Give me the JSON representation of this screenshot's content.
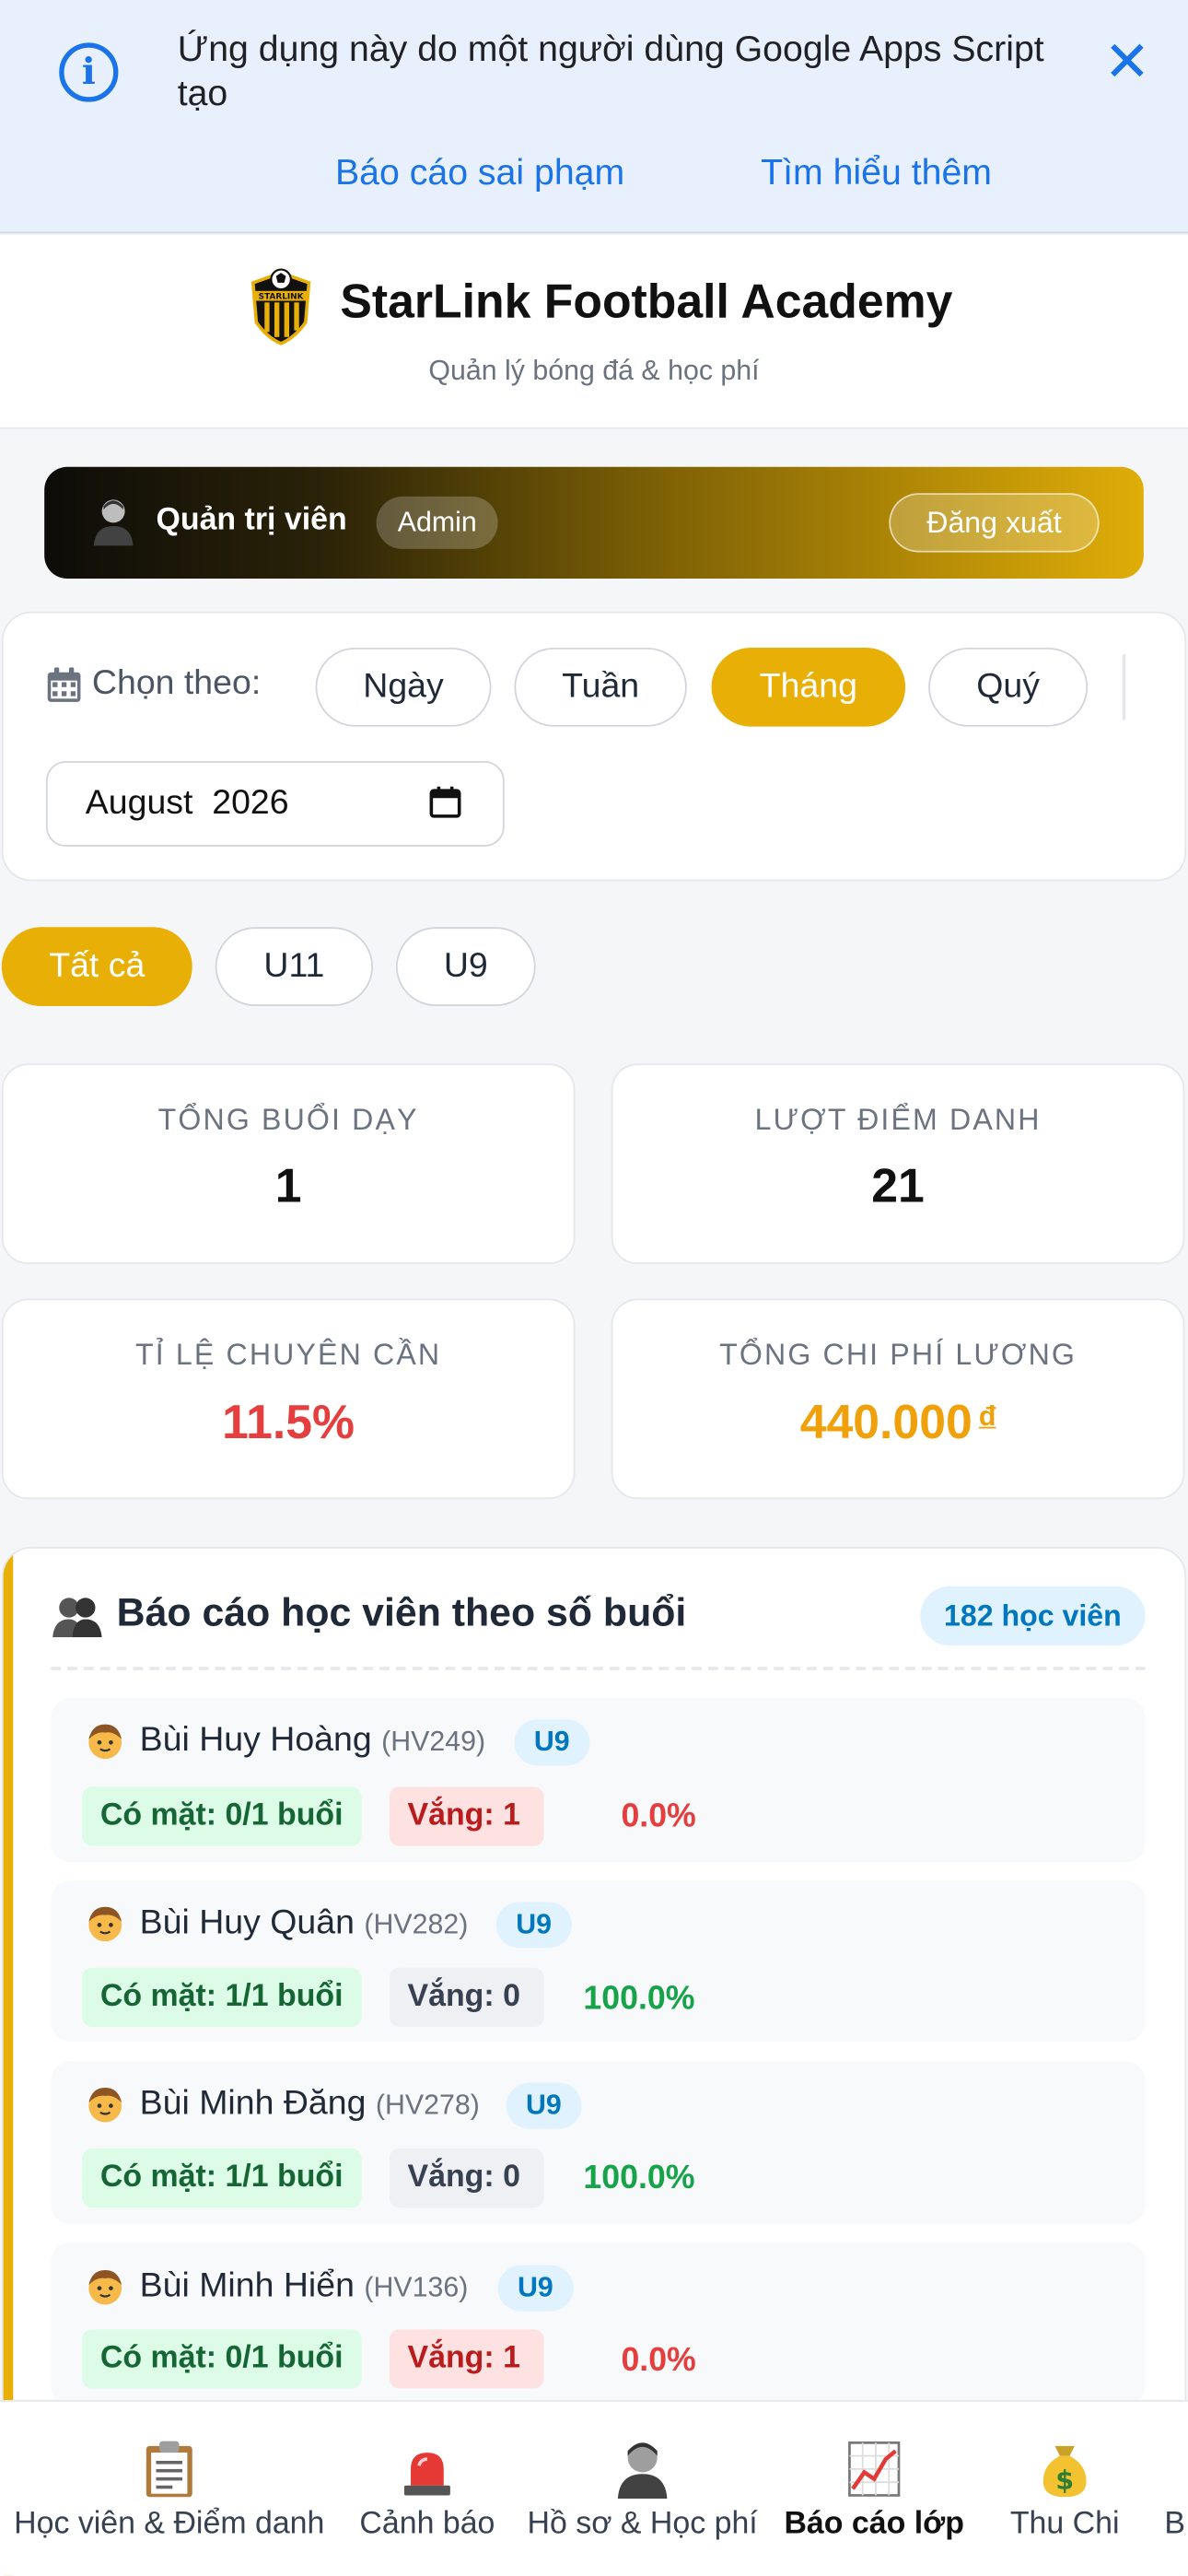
{
  "banner": {
    "message": "Ứng dụng này do một người dùng Google Apps Script tạo",
    "report_link": "Báo cáo sai phạm",
    "learn_link": "Tìm hiểu thêm",
    "close_icon": "close-icon",
    "info_icon": "info-icon",
    "info_glyph": "i",
    "close_glyph": "✕"
  },
  "header": {
    "title": "StarLink Football Academy",
    "subtitle": "Quản lý bóng đá & học phí",
    "logo_text": "STARLINK"
  },
  "user": {
    "name": "Quản trị viên",
    "role": "Admin",
    "logout_label": "Đăng xuất"
  },
  "filter": {
    "label": "Chọn theo:",
    "periods": [
      "Ngày",
      "Tuần",
      "Tháng",
      "Quý"
    ],
    "selected_period": "Tháng",
    "month_value": "August  2026"
  },
  "groups": {
    "items": [
      "Tất cả",
      "U11",
      "U9"
    ],
    "selected": "Tất cả"
  },
  "stats": {
    "total_sessions_label": "TỔNG BUỔI DẠY",
    "total_sessions_value": "1",
    "attendance_label": "LƯỢT ĐIỂM DANH",
    "attendance_value": "21",
    "rate_label": "TỈ LỆ CHUYÊN CẦN",
    "rate_value": "11.5%",
    "salary_label": "TỔNG CHI PHÍ LƯƠNG",
    "salary_value": "440.000",
    "currency": "đ"
  },
  "report": {
    "title": "Báo cáo học viên theo số buổi",
    "count_badge": "182 học viên",
    "students": [
      {
        "name": "Bùi Huy Hoàng",
        "id": "(HV249)",
        "group": "U9",
        "present": "Có mặt: 0/1 buổi",
        "absent": "Vắng: 1",
        "rate": "0.0%"
      },
      {
        "name": "Bùi Huy Quân",
        "id": "(HV282)",
        "group": "U9",
        "present": "Có mặt: 1/1 buổi",
        "absent": "Vắng: 0",
        "rate": "100.0%"
      },
      {
        "name": "Bùi Minh Đăng",
        "id": "(HV278)",
        "group": "U9",
        "present": "Có mặt: 1/1 buổi",
        "absent": "Vắng: 0",
        "rate": "100.0%"
      },
      {
        "name": "Bùi Minh Hiển",
        "id": "(HV136)",
        "group": "U9",
        "present": "Có mặt: 0/1 buổi",
        "absent": "Vắng: 1",
        "rate": "0.0%"
      }
    ]
  },
  "nav": {
    "items": [
      {
        "label": "Học viên & Điểm danh",
        "icon": "clipboard-icon"
      },
      {
        "label": "Cảnh báo",
        "icon": "siren-icon"
      },
      {
        "label": "Hồ sơ & Học phí",
        "icon": "person-icon"
      },
      {
        "label": "Báo cáo lớp",
        "icon": "chart-icon"
      },
      {
        "label": "Thu Chi",
        "icon": "money-bag-icon"
      },
      {
        "label": "B",
        "icon": ""
      }
    ],
    "active": "Báo cáo lớp"
  },
  "colors": {
    "accent": "#e8b007",
    "link": "#1a73e8",
    "danger": "#e53e3e",
    "success": "#16a34a",
    "badge_bg": "#e0f2fe",
    "badge_text": "#0277bd"
  }
}
